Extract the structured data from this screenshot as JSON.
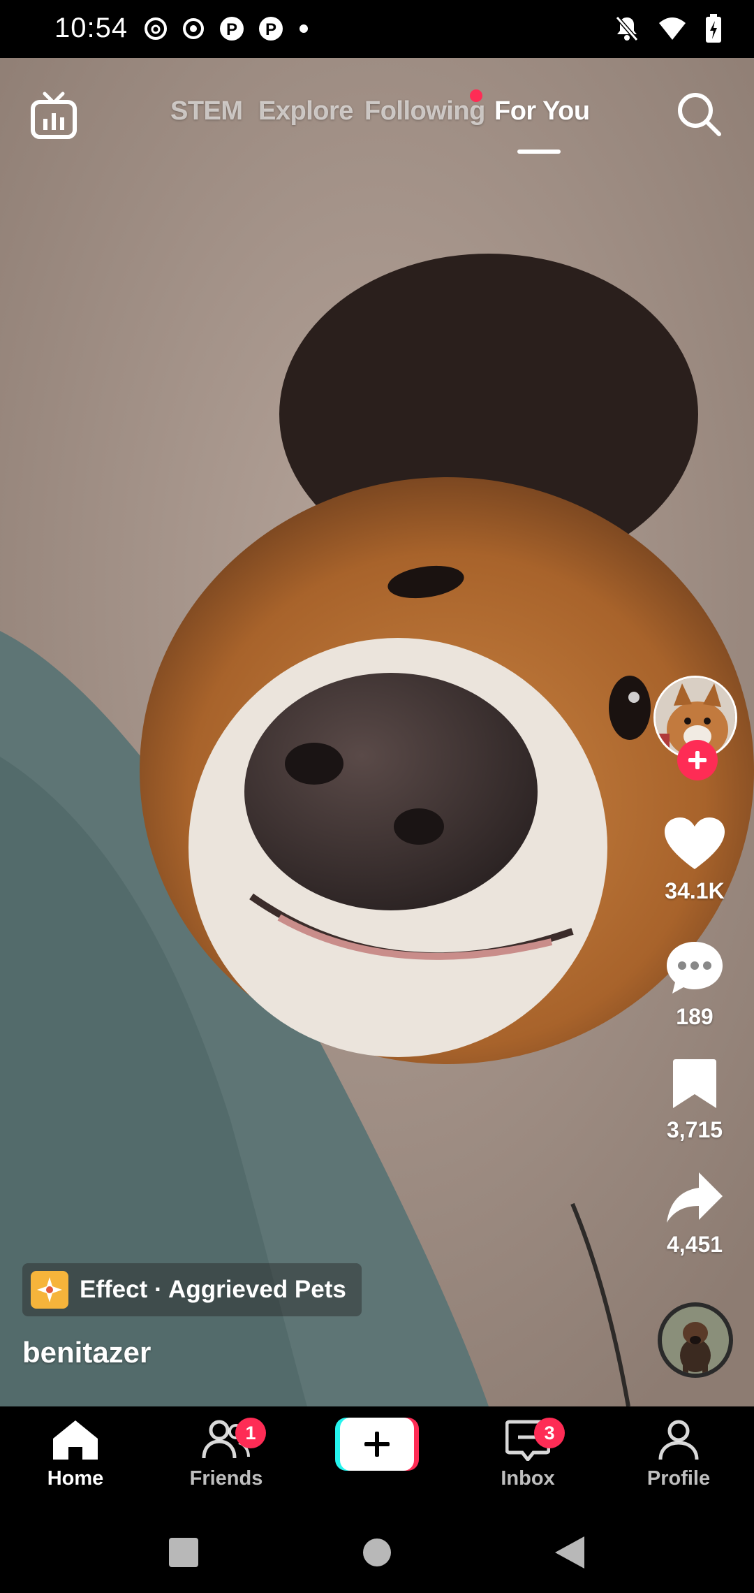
{
  "status_bar": {
    "time": "10:54",
    "left_icons": [
      "threads-icon",
      "record-icon",
      "pinterest-icon",
      "pinterest-icon",
      "dot-icon"
    ],
    "right_icons": [
      "mute-icon",
      "wifi-icon",
      "battery-charging-icon"
    ]
  },
  "top_nav": {
    "tabs": [
      {
        "label": "STEM",
        "active": false
      },
      {
        "label": "Explore",
        "active": false
      },
      {
        "label": "Following",
        "active": false,
        "has_dot": true
      },
      {
        "label": "For You",
        "active": true
      }
    ],
    "left_icon": "live-tv-icon",
    "right_icon": "search-icon"
  },
  "video": {
    "description": "dog close-up",
    "effect_label": "Effect · Aggrieved Pets",
    "username": "benitazer"
  },
  "actions": {
    "likes": "34.1K",
    "comments": "189",
    "saves": "3,715",
    "shares": "4,451"
  },
  "bottom_nav": {
    "home": "Home",
    "friends": "Friends",
    "friends_badge": "1",
    "inbox": "Inbox",
    "inbox_badge": "3",
    "profile": "Profile"
  },
  "colors": {
    "accent": "#fe2c55",
    "effect_icon_bg": "#f6b43b"
  }
}
